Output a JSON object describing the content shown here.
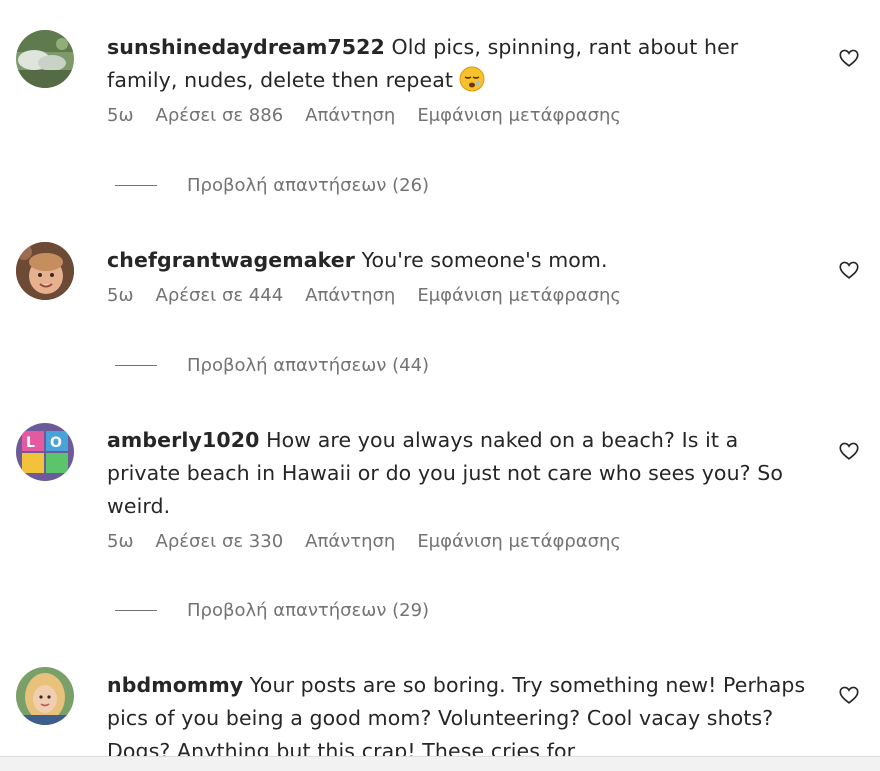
{
  "comments": [
    {
      "username": "sunshinedaydream7522",
      "text": "Old pics, spinning, rant about her family, nudes, delete then repeat",
      "emoji": "sleepy-face-emoji",
      "time": "5ω",
      "likes": "Αρέσει σε 886",
      "reply_label": "Απάντηση",
      "translate_label": "Εμφάνιση μετάφρασης",
      "replies_label": "Προβολή απαντήσεων (26)"
    },
    {
      "username": "chefgrantwagemaker",
      "text": "You're someone's mom.",
      "time": "5ω",
      "likes": "Αρέσει σε 444",
      "reply_label": "Απάντηση",
      "translate_label": "Εμφάνιση μετάφρασης",
      "replies_label": "Προβολή απαντήσεων (44)"
    },
    {
      "username": "amberly1020",
      "text": "How are you always naked on a beach? Is it a private beach in Hawaii or do you just not care who sees you? So weird.",
      "time": "5ω",
      "likes": "Αρέσει σε 330",
      "reply_label": "Απάντηση",
      "translate_label": "Εμφάνιση μετάφρασης",
      "replies_label": "Προβολή απαντήσεων (29)"
    },
    {
      "username": "nbdmommy",
      "text": "Your posts are so boring. Try something new! Perhaps pics of you being a good mom? Volunteering? Cool vacay shots? Dogs? Anything but this crap! These cries for"
    }
  ],
  "colors": {
    "text": "#262626",
    "secondary": "#737373"
  }
}
